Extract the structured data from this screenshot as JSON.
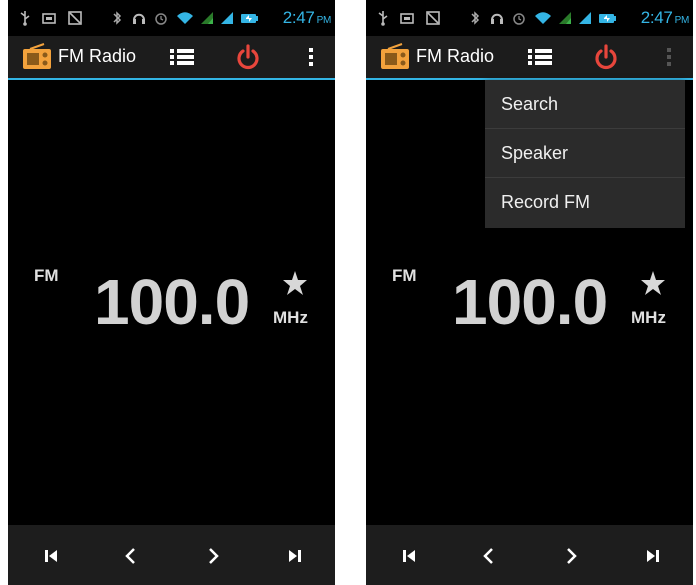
{
  "screens": [
    {
      "status_bar": {
        "time": "2:47",
        "ampm": "PM"
      },
      "action_bar": {
        "title": "FM Radio",
        "overflow_open": false
      },
      "tuner": {
        "band_label": "FM",
        "frequency": "100.0",
        "unit_label": "MHz"
      }
    },
    {
      "status_bar": {
        "time": "2:47",
        "ampm": "PM"
      },
      "action_bar": {
        "title": "FM Radio",
        "overflow_open": true
      },
      "tuner": {
        "band_label": "FM",
        "frequency": "100.0",
        "unit_label": "MHz"
      },
      "overflow_menu": {
        "items": [
          "Search",
          "Speaker",
          "Record FM"
        ]
      }
    }
  ],
  "icons": {
    "status": [
      "usb-icon",
      "sd-card-icon",
      "notification-icon",
      "bluetooth-icon",
      "headset-icon",
      "alarm-icon",
      "wifi-icon",
      "signal-icon",
      "signal-icon",
      "battery-icon"
    ],
    "app": "radio-icon",
    "action": [
      "list-icon",
      "power-icon",
      "overflow-icon"
    ],
    "tuner": "star-icon",
    "nav": [
      "skip-previous-icon",
      "chevron-left-icon",
      "chevron-right-icon",
      "skip-next-icon"
    ]
  },
  "colors": {
    "accent": "#33b5e5",
    "power": "#e8463c",
    "app_icon": "#f3a23c",
    "frequency_text": "#d2d2d2",
    "background": "#000000"
  }
}
